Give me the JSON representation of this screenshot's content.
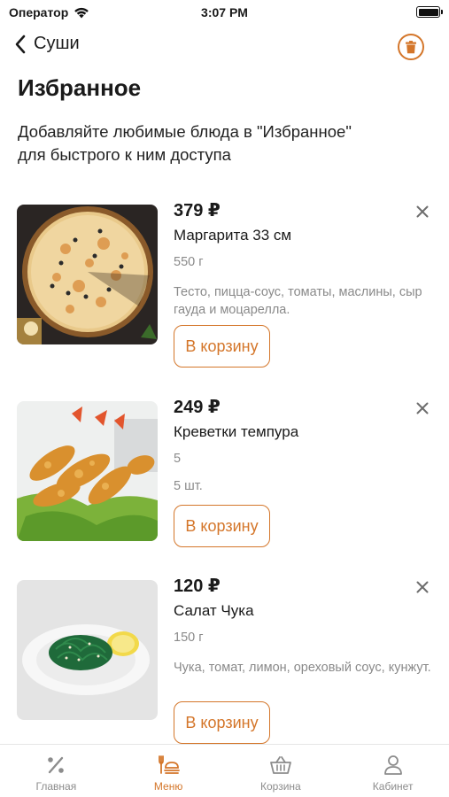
{
  "status_bar": {
    "carrier": "Оператор",
    "time": "3:07 PM"
  },
  "nav": {
    "back_label": "Суши"
  },
  "page": {
    "title": "Избранное",
    "subtitle": "Добавляйте любимые блюда в \"Избранное\"\nдля быстрого к ним доступа"
  },
  "items": [
    {
      "price": "379 ₽",
      "name": "Маргарита 33 см",
      "weight": "550 г",
      "count": "",
      "description": "Тесто, пицца-соус, томаты, маслины, сыр гауда и моцарелла.",
      "button_label": "В корзину",
      "image": "pizza"
    },
    {
      "price": "249 ₽",
      "name": "Креветки темпура",
      "weight": "5",
      "count": "5 шт.",
      "description": "",
      "button_label": "В корзину",
      "image": "shrimp-tempura"
    },
    {
      "price": "120 ₽",
      "name": "Салат Чука",
      "weight": "150 г",
      "count": "",
      "description": "Чука, томат, лимон, ореховый соус, кунжут.",
      "button_label": "В корзину",
      "image": "chuka-salad"
    }
  ],
  "tab_bar": [
    {
      "label": "Главная",
      "icon": "percent-icon",
      "active": false
    },
    {
      "label": "Меню",
      "icon": "menu-icon",
      "active": true
    },
    {
      "label": "Корзина",
      "icon": "basket-icon",
      "active": false
    },
    {
      "label": "Кабинет",
      "icon": "user-icon",
      "active": false
    }
  ],
  "colors": {
    "accent": "#d4762a",
    "muted": "#8a8a8a"
  }
}
